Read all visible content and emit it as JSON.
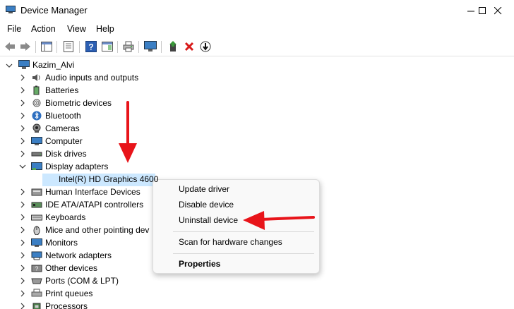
{
  "window": {
    "title": "Device Manager"
  },
  "menu": {
    "file": "File",
    "action": "Action",
    "view": "View",
    "help": "Help"
  },
  "tree": {
    "root": "Kazim_Alvi",
    "categories": [
      "Audio inputs and outputs",
      "Batteries",
      "Biometric devices",
      "Bluetooth",
      "Cameras",
      "Computer",
      "Disk drives",
      "Display adapters",
      "Intel(R) HD Graphics 4600",
      "Human Interface Devices",
      "IDE ATA/ATAPI controllers",
      "Keyboards",
      "Mice and other pointing dev",
      "Monitors",
      "Network adapters",
      "Other devices",
      "Ports (COM & LPT)",
      "Print queues",
      "Processors"
    ]
  },
  "context_menu": {
    "update_driver": "Update driver",
    "disable_device": "Disable device",
    "uninstall_device": "Uninstall device",
    "scan": "Scan for hardware changes",
    "properties": "Properties"
  },
  "colors": {
    "accent": "#e8141a",
    "selection": "#cce8ff"
  }
}
